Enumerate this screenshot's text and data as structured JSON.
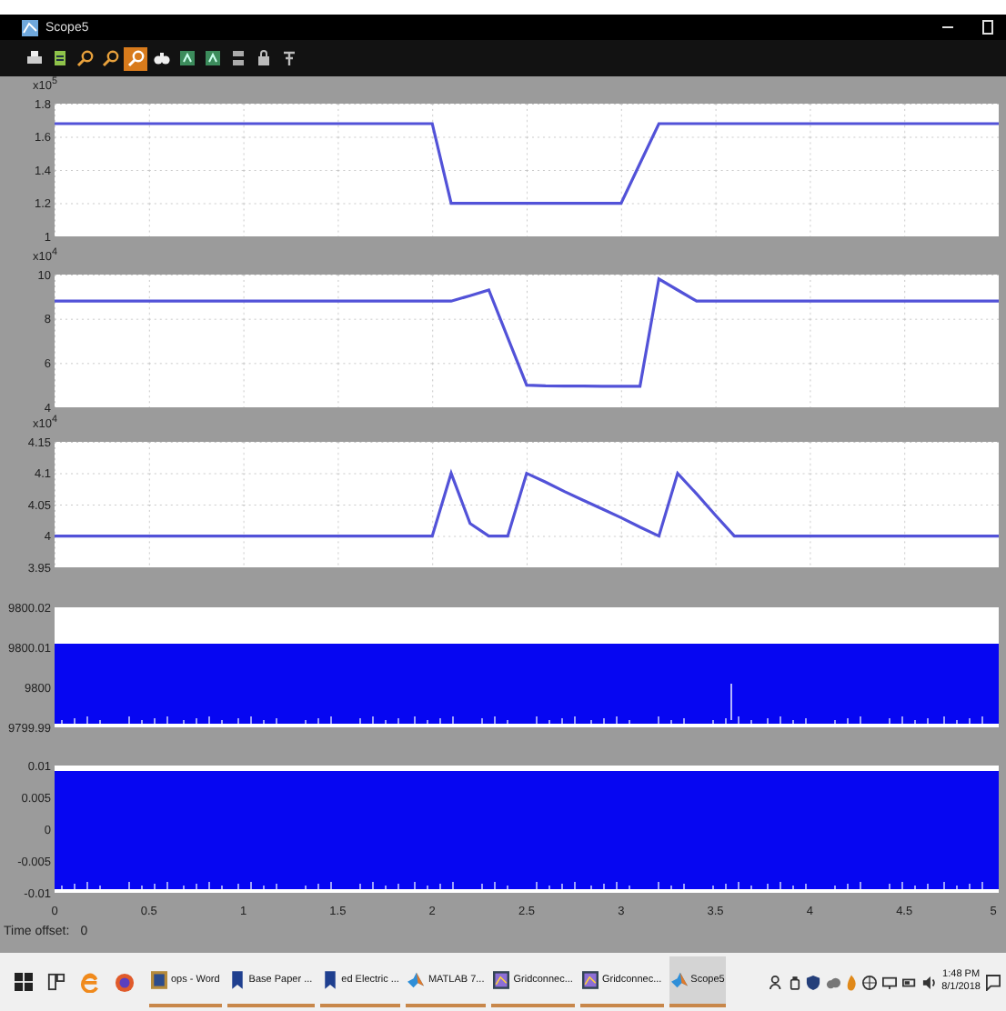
{
  "window": {
    "title": "Scope5"
  },
  "toolbar": [
    {
      "kind": "print",
      "selected": false
    },
    {
      "kind": "params",
      "selected": false
    },
    {
      "kind": "zoom",
      "selected": false
    },
    {
      "kind": "zoom-x",
      "selected": false
    },
    {
      "kind": "zoom-y",
      "selected": true
    },
    {
      "kind": "autoscale",
      "selected": false
    },
    {
      "kind": "save-axes",
      "selected": false
    },
    {
      "kind": "restore-axes",
      "selected": false
    },
    {
      "kind": "float",
      "selected": false
    },
    {
      "kind": "lock",
      "selected": false
    },
    {
      "kind": "signal-select",
      "selected": false
    }
  ],
  "scope": {
    "panels": [
      {
        "kind": "line",
        "exponent": "x10$^{5}$",
        "chart_data": {
          "type": "line",
          "categories": [
            null,
            null,
            null,
            null,
            null,
            null,
            null,
            null,
            null,
            null,
            null,
            null,
            null,
            null,
            null,
            null,
            null,
            null,
            null,
            null,
            null,
            null,
            null,
            null,
            null,
            null,
            null,
            null,
            null,
            null,
            null,
            null,
            null,
            null,
            null,
            null,
            null,
            null,
            null,
            null,
            null,
            null,
            null,
            null,
            null,
            null,
            null,
            null,
            null,
            null,
            null
          ],
          "series": [
            {
              "color": "#5252d8",
              "values": [
                1.68,
                1.68,
                1.68,
                1.68,
                1.68,
                1.68,
                1.68,
                1.68,
                1.68,
                1.68,
                1.68,
                1.68,
                1.68,
                1.68,
                1.68,
                1.68,
                1.68,
                1.68,
                1.68,
                1.68,
                1.68,
                1.2,
                1.2,
                1.2,
                1.2,
                1.2,
                1.2,
                1.2,
                1.2,
                1.2,
                1.2,
                1.44,
                1.68,
                1.68,
                1.68,
                1.68,
                1.68,
                1.68,
                1.68,
                1.68,
                1.68,
                1.68,
                1.68,
                1.68,
                1.68,
                1.68,
                1.68,
                1.68,
                1.68,
                1.68,
                1.68
              ]
            }
          ],
          "ylim": [
            1,
            1.8
          ],
          "yticks": [
            {
              "value": 1.8,
              "label": "1.8"
            },
            {
              "value": 1.6,
              "label": "1.6"
            },
            {
              "value": 1.4,
              "label": "1.4"
            },
            {
              "value": 1.2,
              "label": "1.2"
            },
            {
              "value": 1,
              "label": "1"
            }
          ]
        }
      },
      {
        "kind": "line",
        "exponent": "x10$^{4}$",
        "chart_data": {
          "type": "line",
          "categories": [
            null,
            null,
            null,
            null,
            null,
            null,
            null,
            null,
            null,
            null,
            null,
            null,
            null,
            null,
            null,
            null,
            null,
            null,
            null,
            null,
            null,
            null,
            null,
            null,
            null,
            null,
            null,
            null,
            null,
            null,
            null,
            null,
            null,
            null,
            null,
            null,
            null,
            null,
            null,
            null,
            null,
            null,
            null,
            null,
            null,
            null,
            null,
            null,
            null,
            null,
            null
          ],
          "series": [
            {
              "color": "#5252d8",
              "values": [
                8.8,
                8.8,
                8.8,
                8.8,
                8.8,
                8.8,
                8.8,
                8.8,
                8.8,
                8.8,
                8.8,
                8.8,
                8.8,
                8.8,
                8.8,
                8.8,
                8.8,
                8.8,
                8.8,
                8.8,
                8.8,
                8.8,
                9.05,
                9.3,
                7.15,
                5,
                4.97,
                4.96,
                4.96,
                4.95,
                4.95,
                4.95,
                9.8,
                9.3,
                8.8,
                8.8,
                8.8,
                8.8,
                8.8,
                8.8,
                8.8,
                8.8,
                8.8,
                8.8,
                8.8,
                8.8,
                8.8,
                8.8,
                8.8,
                8.8,
                8.8
              ]
            }
          ],
          "ylim": [
            4,
            10
          ],
          "yticks": [
            {
              "value": 10,
              "label": "10"
            },
            {
              "value": 8,
              "label": "8"
            },
            {
              "value": 6,
              "label": "6"
            },
            {
              "value": 4,
              "label": "4"
            }
          ]
        }
      },
      {
        "kind": "line",
        "exponent": "x10$^{4}$",
        "chart_data": {
          "type": "line",
          "categories": [
            null,
            null,
            null,
            null,
            null,
            null,
            null,
            null,
            null,
            null,
            null,
            null,
            null,
            null,
            null,
            null,
            null,
            null,
            null,
            null,
            null,
            null,
            null,
            null,
            null,
            null,
            null,
            null,
            null,
            null,
            null,
            null,
            null,
            null,
            null,
            null,
            null,
            null,
            null,
            null,
            null,
            null,
            null,
            null,
            null,
            null,
            null,
            null,
            null,
            null,
            null
          ],
          "series": [
            {
              "color": "#5252d8",
              "values": [
                4,
                4,
                4,
                4,
                4,
                4,
                4,
                4,
                4,
                4,
                4,
                4,
                4,
                4,
                4,
                4,
                4,
                4,
                4,
                4,
                4,
                4.1,
                4.02,
                4,
                4,
                4.1,
                4.086,
                4.071,
                4.057,
                4.043,
                4.029,
                4.014,
                4,
                4.1,
                4.067,
                4.033,
                4,
                4,
                4,
                4,
                4,
                4,
                4,
                4,
                4,
                4,
                4,
                4,
                4,
                4,
                4
              ]
            }
          ],
          "ylim": [
            3.95,
            4.15
          ],
          "yticks": [
            {
              "value": 4.15,
              "label": "4.15"
            },
            {
              "value": 4.1,
              "label": "4.1"
            },
            {
              "value": 4.05,
              "label": "4.05"
            },
            {
              "value": 4,
              "label": "4"
            },
            {
              "value": 3.95,
              "label": "3.95"
            }
          ]
        }
      },
      {
        "kind": "noise_band",
        "ytick_labels": [
          "9800.02",
          "9800.01",
          "9800",
          "9799.99"
        ]
      },
      {
        "kind": "noise_fill",
        "ytick_labels": [
          "0.01",
          "0.005",
          "0",
          "-0.005",
          "-0.01"
        ]
      }
    ],
    "x_axis_labels": [
      "0",
      "0.5",
      "1",
      "1.5",
      "2",
      "2.5",
      "3",
      "3.5",
      "4",
      "4.5",
      "5"
    ],
    "time_offset_label": "Time offset:",
    "time_offset_value": "0"
  },
  "taskbar": {
    "apps": [
      {
        "kind": "word",
        "label": "ops - Word",
        "selected": false
      },
      {
        "kind": "doc",
        "label": "Base Paper ...",
        "selected": false
      },
      {
        "kind": "doc",
        "label": "ed Electric ...",
        "selected": false
      },
      {
        "kind": "matlab",
        "label": "MATLAB 7...",
        "selected": false
      },
      {
        "kind": "image",
        "label": "Gridconnec...",
        "selected": false
      },
      {
        "kind": "image",
        "label": "Gridconnec...",
        "selected": false
      },
      {
        "kind": "matlab",
        "label": "Scope5",
        "selected": true
      }
    ],
    "time": "1:48 PM",
    "date": "8/1/2018"
  }
}
